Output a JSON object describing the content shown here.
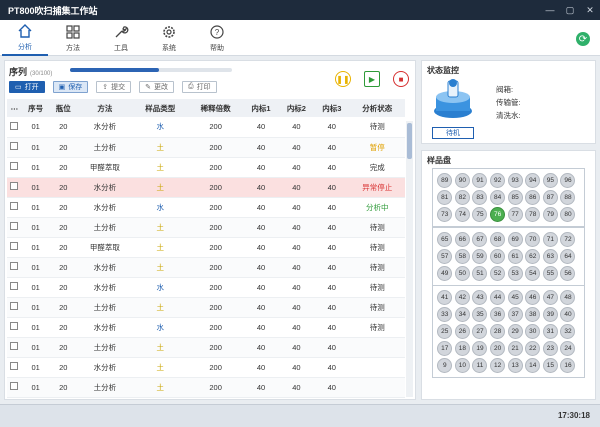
{
  "app": {
    "title": "PT800吹扫捕集工作站",
    "window": {
      "minimize": "—",
      "maximize": "▢",
      "close": "✕"
    }
  },
  "toolbar": [
    {
      "label": "分析",
      "icon": "home-icon",
      "active": true
    },
    {
      "label": "方法",
      "icon": "grid-icon"
    },
    {
      "label": "工具",
      "icon": "wrench-icon"
    },
    {
      "label": "系统",
      "icon": "gear-icon"
    },
    {
      "label": "帮助",
      "icon": "help-icon"
    }
  ],
  "sequence": {
    "title": "序列",
    "count": "(30/100)",
    "progress": 0.55,
    "buttons": {
      "open": "打开",
      "save": "保存",
      "submit": "提交",
      "modify": "更改",
      "print": "打印"
    },
    "controls": {
      "pause": "pause-icon",
      "play": "play-icon",
      "stop": "stop-icon"
    },
    "columns": [
      "⋯",
      "序号",
      "瓶位",
      "方法",
      "样品类型",
      "稀释倍数",
      "内标1",
      "内标2",
      "内标3",
      "分析状态"
    ],
    "rows": [
      {
        "seq": "01",
        "pos": "20",
        "method": "水分析",
        "type": "水",
        "type_class": "water",
        "dilution": "200",
        "is1": "40",
        "is2": "40",
        "is3": "40",
        "status": "待测",
        "status_class": ""
      },
      {
        "seq": "01",
        "pos": "20",
        "method": "土分析",
        "type": "土",
        "type_class": "soil",
        "dilution": "200",
        "is1": "40",
        "is2": "40",
        "is3": "40",
        "status": "暂停",
        "status_class": "st-pause"
      },
      {
        "seq": "01",
        "pos": "20",
        "method": "甲醛萃取",
        "type": "土",
        "type_class": "soil",
        "dilution": "200",
        "is1": "40",
        "is2": "40",
        "is3": "40",
        "status": "完成",
        "status_class": ""
      },
      {
        "seq": "01",
        "pos": "20",
        "method": "水分析",
        "type": "土",
        "type_class": "soil",
        "dilution": "200",
        "is1": "40",
        "is2": "40",
        "is3": "40",
        "status": "异常停止",
        "status_class": "st-err"
      },
      {
        "seq": "01",
        "pos": "20",
        "method": "水分析",
        "type": "水",
        "type_class": "water",
        "dilution": "200",
        "is1": "40",
        "is2": "40",
        "is3": "40",
        "status": "分析中",
        "status_class": "st-run"
      },
      {
        "seq": "01",
        "pos": "20",
        "method": "土分析",
        "type": "土",
        "type_class": "soil",
        "dilution": "200",
        "is1": "40",
        "is2": "40",
        "is3": "40",
        "status": "待测",
        "status_class": ""
      },
      {
        "seq": "01",
        "pos": "20",
        "method": "甲醛萃取",
        "type": "土",
        "type_class": "soil",
        "dilution": "200",
        "is1": "40",
        "is2": "40",
        "is3": "40",
        "status": "待测",
        "status_class": ""
      },
      {
        "seq": "01",
        "pos": "20",
        "method": "水分析",
        "type": "土",
        "type_class": "soil",
        "dilution": "200",
        "is1": "40",
        "is2": "40",
        "is3": "40",
        "status": "待测",
        "status_class": ""
      },
      {
        "seq": "01",
        "pos": "20",
        "method": "水分析",
        "type": "水",
        "type_class": "water",
        "dilution": "200",
        "is1": "40",
        "is2": "40",
        "is3": "40",
        "status": "待测",
        "status_class": ""
      },
      {
        "seq": "01",
        "pos": "20",
        "method": "土分析",
        "type": "土",
        "type_class": "soil",
        "dilution": "200",
        "is1": "40",
        "is2": "40",
        "is3": "40",
        "status": "待测",
        "status_class": ""
      },
      {
        "seq": "01",
        "pos": "20",
        "method": "水分析",
        "type": "水",
        "type_class": "water",
        "dilution": "200",
        "is1": "40",
        "is2": "40",
        "is3": "40",
        "status": "待测",
        "status_class": ""
      },
      {
        "seq": "01",
        "pos": "20",
        "method": "土分析",
        "type": "土",
        "type_class": "soil",
        "dilution": "200",
        "is1": "40",
        "is2": "40",
        "is3": "40",
        "status": "",
        "status_class": ""
      },
      {
        "seq": "01",
        "pos": "20",
        "method": "水分析",
        "type": "土",
        "type_class": "soil",
        "dilution": "200",
        "is1": "40",
        "is2": "40",
        "is3": "40",
        "status": "",
        "status_class": ""
      },
      {
        "seq": "01",
        "pos": "20",
        "method": "土分析",
        "type": "土",
        "type_class": "soil",
        "dilution": "200",
        "is1": "40",
        "is2": "40",
        "is3": "40",
        "status": "",
        "status_class": ""
      }
    ]
  },
  "status_monitor": {
    "title": "状态监控",
    "state": "待机",
    "labels": {
      "valve": "阀箱:",
      "transfer": "传输管:",
      "rinse": "清洗水:"
    }
  },
  "tray": {
    "title": "样品盘",
    "active": "76",
    "racks": [
      [
        "89",
        "90",
        "91",
        "92",
        "93",
        "94",
        "95",
        "96",
        "81",
        "82",
        "83",
        "84",
        "85",
        "86",
        "87",
        "88",
        "73",
        "74",
        "75",
        "76",
        "77",
        "78",
        "79",
        "80"
      ],
      [
        "65",
        "66",
        "67",
        "68",
        "69",
        "70",
        "71",
        "72",
        "57",
        "58",
        "59",
        "60",
        "61",
        "62",
        "63",
        "64",
        "49",
        "50",
        "51",
        "52",
        "53",
        "54",
        "55",
        "56"
      ],
      [
        "41",
        "42",
        "43",
        "44",
        "45",
        "46",
        "47",
        "48",
        "33",
        "34",
        "35",
        "36",
        "37",
        "38",
        "39",
        "40",
        "25",
        "26",
        "27",
        "28",
        "29",
        "30",
        "31",
        "32",
        "17",
        "18",
        "19",
        "20",
        "21",
        "22",
        "23",
        "24",
        "9",
        "10",
        "11",
        "12",
        "13",
        "14",
        "15",
        "16"
      ]
    ]
  },
  "statusbar": {
    "time": "17:30:18"
  }
}
